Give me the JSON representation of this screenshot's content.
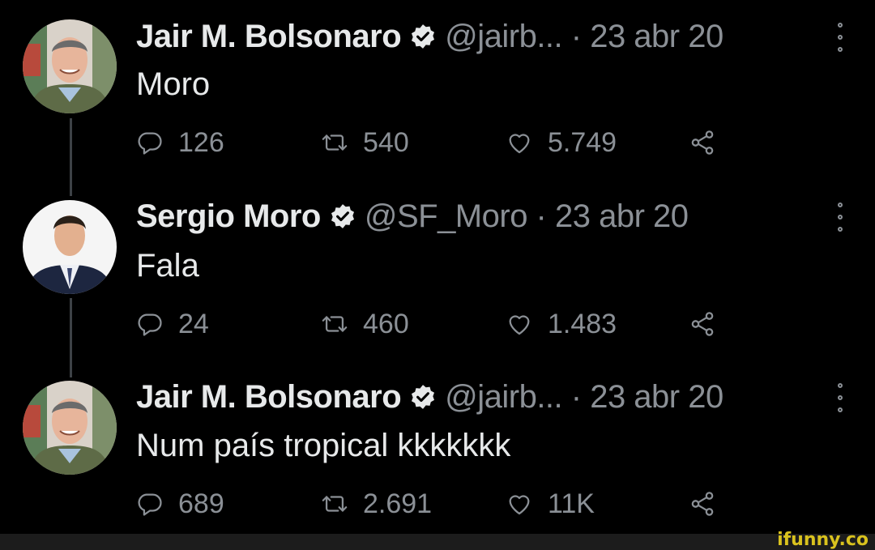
{
  "tweets": [
    {
      "name": "Jair M. Bolsonaro",
      "handle_time": "@jairb... · 23 abr 20",
      "text": "Moro",
      "replies": "126",
      "retweets": "540",
      "likes": "5.749"
    },
    {
      "name": "Sergio Moro",
      "handle_time": "@SF_Moro · 23 abr 20",
      "text": "Fala",
      "replies": "24",
      "retweets": "460",
      "likes": "1.483"
    },
    {
      "name": "Jair M. Bolsonaro",
      "handle_time": "@jairb... · 23 abr 20",
      "text": "Num país tropical kkkkkkk",
      "replies": "689",
      "retweets": "2.691",
      "likes": "11K"
    }
  ],
  "watermark": "ifunny.co",
  "colors": {
    "background": "#000000",
    "text": "#e7e9ea",
    "muted": "#8b9096",
    "thread_line": "#3d4146"
  },
  "icons": [
    "verified-icon",
    "more-icon",
    "reply-icon",
    "retweet-icon",
    "like-icon",
    "share-icon"
  ]
}
